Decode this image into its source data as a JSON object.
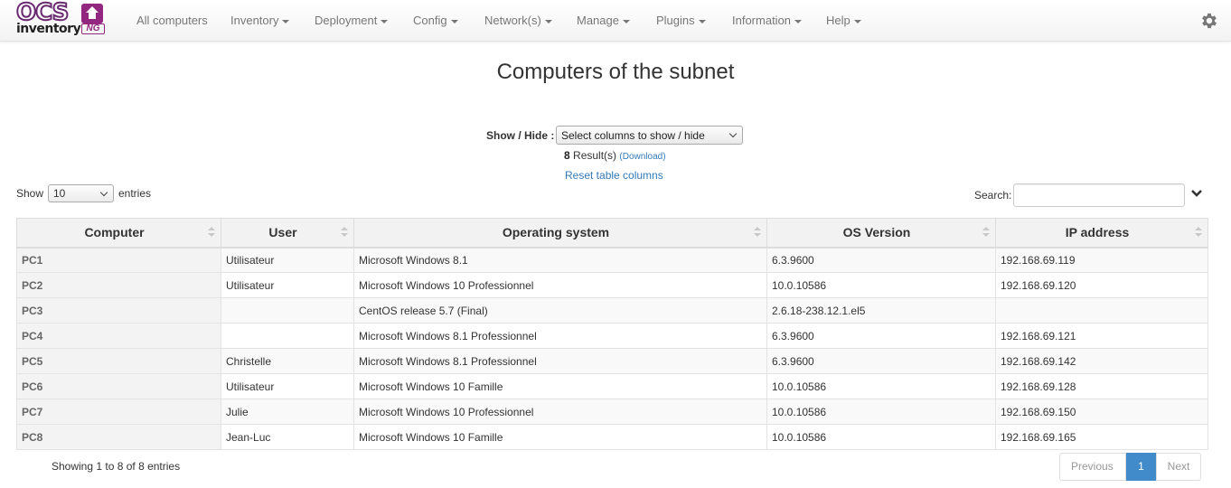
{
  "brand": {
    "top": "OCS",
    "bottom": "inventory",
    "suffix": "NG"
  },
  "nav": {
    "items": [
      {
        "label": "All computers",
        "dropdown": false
      },
      {
        "label": "Inventory",
        "dropdown": true
      },
      {
        "label": "Deployment",
        "dropdown": true
      },
      {
        "label": "Config",
        "dropdown": true
      },
      {
        "label": "Network(s)",
        "dropdown": true
      },
      {
        "label": "Manage",
        "dropdown": true
      },
      {
        "label": "Plugins",
        "dropdown": true
      },
      {
        "label": "Information",
        "dropdown": true
      },
      {
        "label": "Help",
        "dropdown": true
      }
    ],
    "settings_icon": "gear-icon"
  },
  "page": {
    "title": "Computers of the subnet",
    "showhide_label": "Show / Hide :",
    "showhide_select": "Select columns to show / hide",
    "result_count": "8",
    "result_label": "Result(s)",
    "download_label": "(Download)",
    "reset_label": "Reset table columns",
    "show_label": "Show",
    "entries_value": "10",
    "entries_label": "entries",
    "search_label": "Search:",
    "search_value": ""
  },
  "table": {
    "columns": [
      "Computer",
      "User",
      "Operating system",
      "OS Version",
      "IP address"
    ],
    "rows": [
      [
        "PC1",
        "Utilisateur",
        "Microsoft Windows 8.1",
        "6.3.9600",
        "192.168.69.119"
      ],
      [
        "PC2",
        "Utilisateur",
        "Microsoft Windows 10 Professionnel",
        "10.0.10586",
        "192.168.69.120"
      ],
      [
        "PC3",
        "",
        "CentOS release 5.7 (Final)",
        "2.6.18-238.12.1.el5",
        ""
      ],
      [
        "PC4",
        "",
        "Microsoft Windows 8.1 Professionnel",
        "6.3.9600",
        "192.168.69.121"
      ],
      [
        "PC5",
        "Christelle",
        "Microsoft Windows 8.1 Professionnel",
        "6.3.9600",
        "192.168.69.142"
      ],
      [
        "PC6",
        "Utilisateur",
        "Microsoft Windows 10 Famille",
        "10.0.10586",
        "192.168.69.128"
      ],
      [
        "PC7",
        "Julie",
        "Microsoft Windows 10 Professionnel",
        "10.0.10586",
        "192.168.69.150"
      ],
      [
        "PC8",
        "Jean-Luc",
        "Microsoft Windows 10 Famille",
        "10.0.10586",
        "192.168.69.165"
      ]
    ]
  },
  "footer": {
    "info": "Showing 1 to 8 of 8 entries",
    "prev": "Previous",
    "current_page": "1",
    "next": "Next"
  },
  "colors": {
    "accent": "#428bca",
    "link": "#337ab7",
    "brand": "#93267e"
  }
}
